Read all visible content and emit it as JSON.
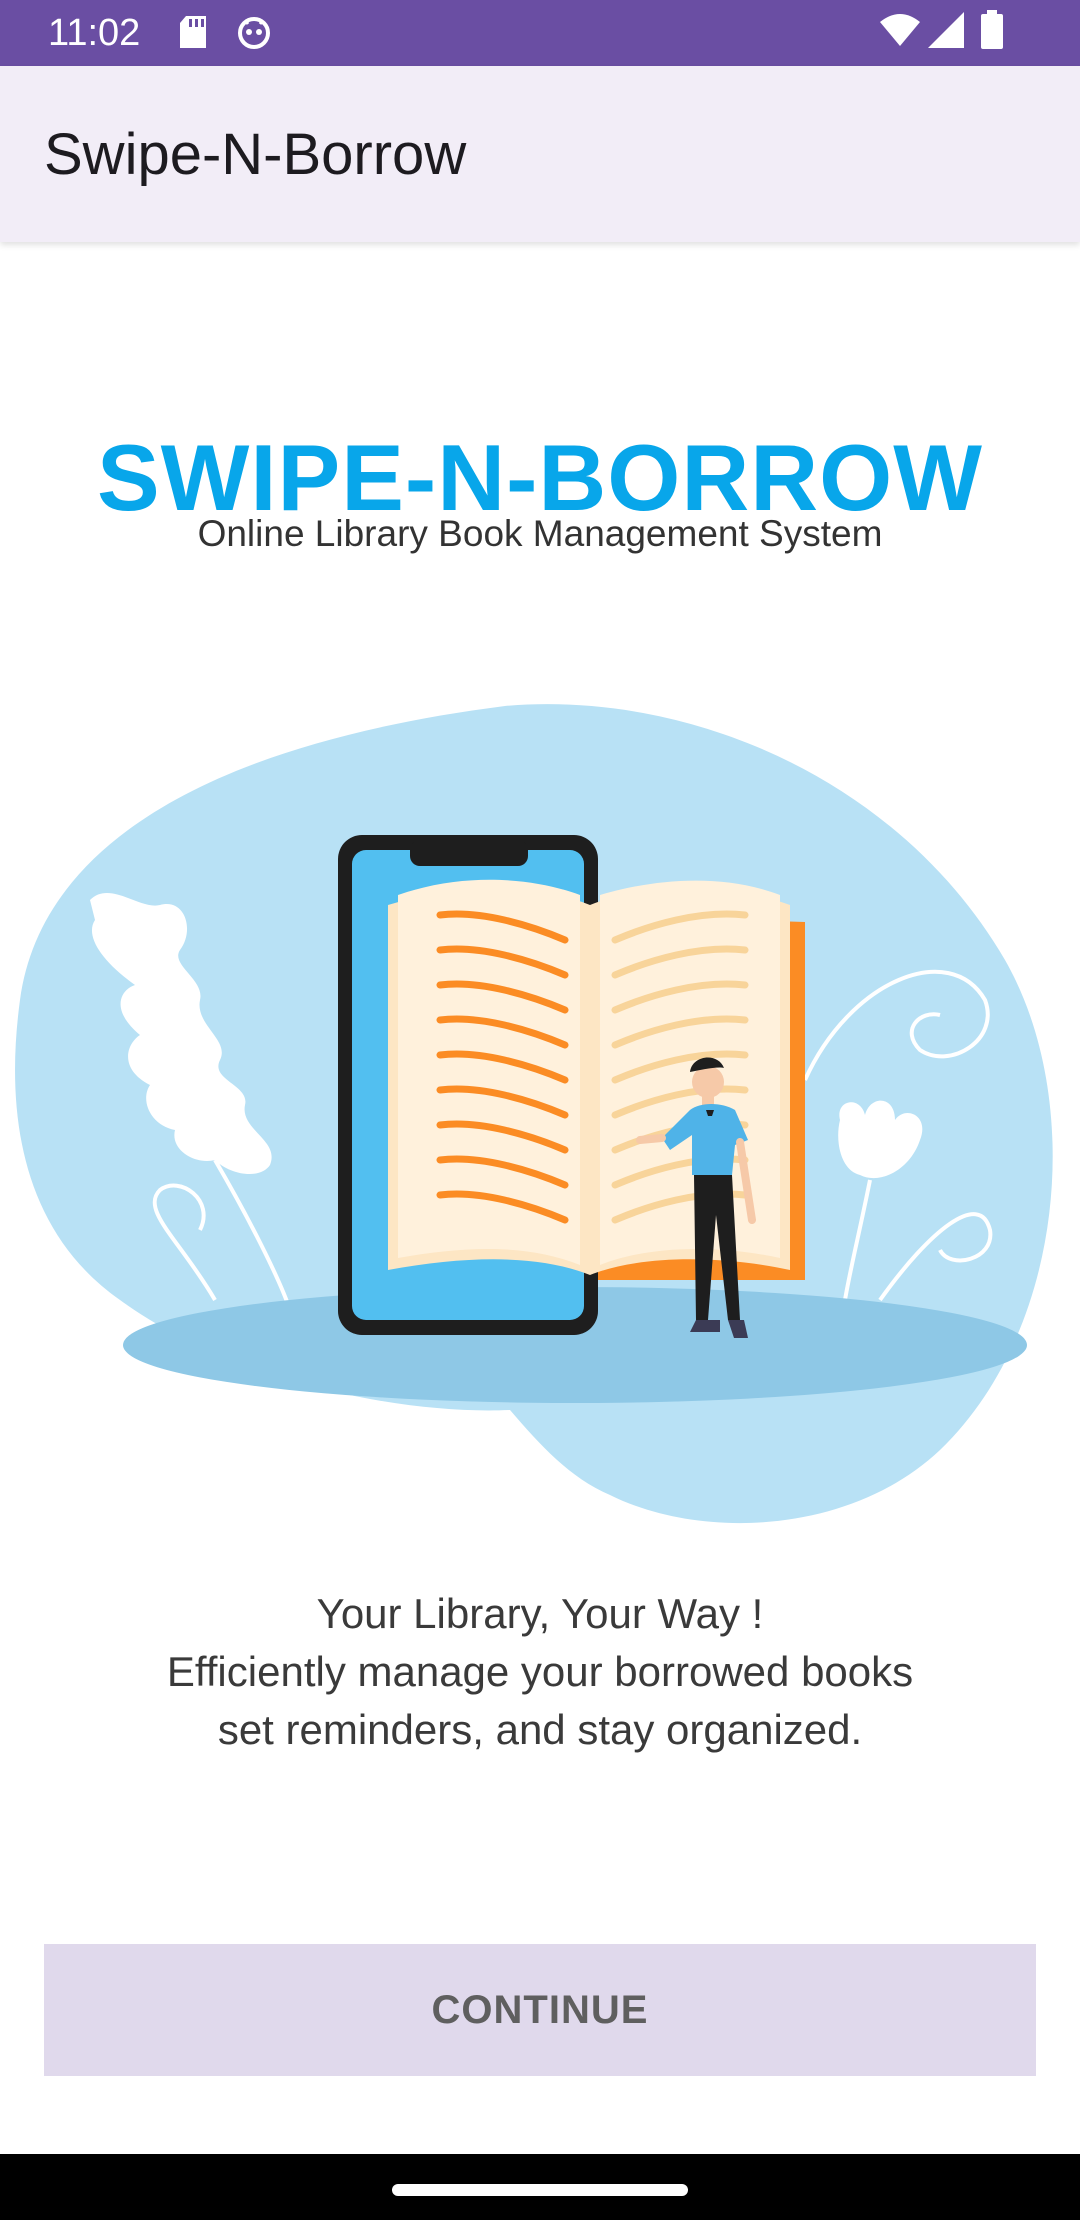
{
  "status_bar": {
    "time": "11:02",
    "left_icons": [
      "sd-card-icon",
      "android-debug-icon"
    ],
    "right_icons": [
      "wifi-icon",
      "signal-icon",
      "battery-icon"
    ]
  },
  "app_bar": {
    "title": "Swipe-N-Borrow"
  },
  "hero": {
    "title": "SWIPE-N-BORROW",
    "subtitle": "Online Library Book Management System"
  },
  "illustration": {
    "icon": "phone-open-book-reader-illustration"
  },
  "tagline": {
    "line1": "Your Library, Your Way !",
    "line2": "Efficiently manage your borrowed books",
    "line3": "set reminders, and stay organized."
  },
  "actions": {
    "continue_label": "CONTINUE"
  },
  "colors": {
    "status_bar": "#6a4ea3",
    "app_bar": "#f2edf7",
    "brand": "#08a6ea",
    "button_bg": "#e0d9ec"
  }
}
